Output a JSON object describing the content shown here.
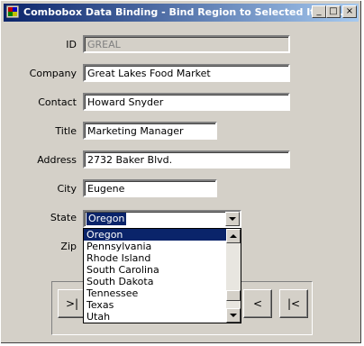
{
  "window": {
    "title": "Combobox Data Binding - Bind Region to Selected Item ..."
  },
  "titlebar_buttons": {
    "minimize": "_",
    "maximize": "□",
    "close": "×"
  },
  "fields": {
    "id_label": "ID",
    "id_value": "GREAL",
    "company_label": "Company",
    "company_value": "Great Lakes Food Market",
    "contact_label": "Contact",
    "contact_value": "Howard Snyder",
    "title_label": "Title",
    "title_value": "Marketing Manager",
    "address_label": "Address",
    "address_value": "2732 Baker Blvd.",
    "city_label": "City",
    "city_value": "Eugene",
    "state_label": "State",
    "state_value": "Oregon",
    "zip_label": "Zip"
  },
  "dropdown": {
    "items": [
      "Oregon",
      "Pennsylvania",
      "Rhode Island",
      "South Carolina",
      "South Dakota",
      "Tennessee",
      "Texas",
      "Utah"
    ],
    "highlighted": "Oregon"
  },
  "nav": {
    "first": ">|",
    "prev": "<",
    "last": "|<"
  }
}
